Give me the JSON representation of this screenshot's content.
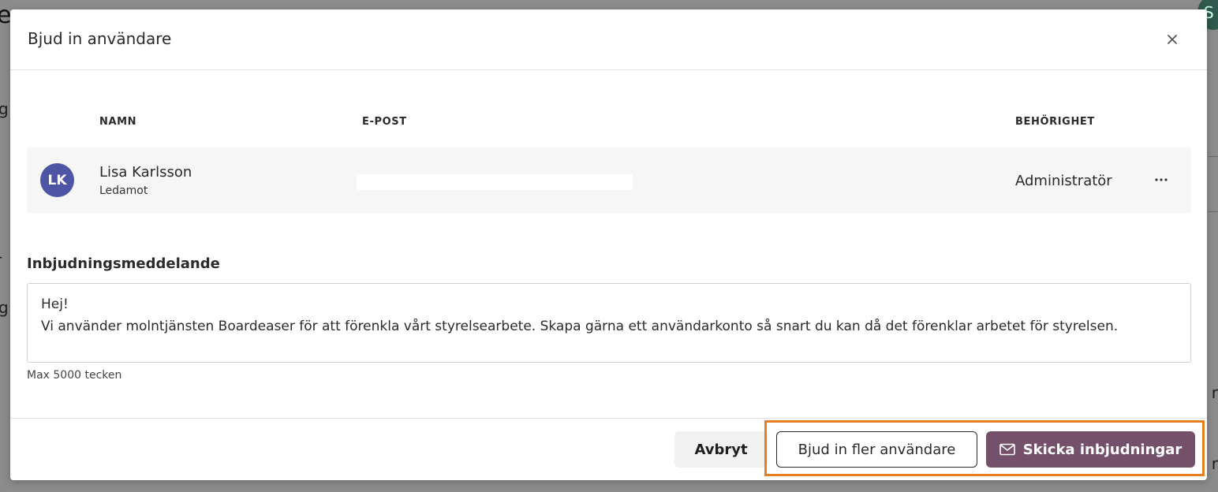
{
  "background": {
    "fragments": [
      "e",
      "g",
      "r",
      "g",
      "r",
      "r"
    ],
    "avatar_letter": "S"
  },
  "modal": {
    "title": "Bjud in användare",
    "close_icon": "close-icon"
  },
  "table": {
    "headers": {
      "name": "NAMN",
      "email": "E-POST",
      "permission": "BEHÖRIGHET"
    },
    "rows": [
      {
        "initials": "LK",
        "name": "Lisa Karlsson",
        "role": "Ledamot",
        "email": "",
        "permission": "Administratör",
        "more_icon": "more-horizontal-icon",
        "avatar_color": "#4e55a5"
      }
    ]
  },
  "message": {
    "label": "Inbjudningsmeddelande",
    "value": "Hej!\nVi använder molntjänsten Boardeaser för att förenkla vårt styrelsearbete. Skapa gärna ett användarkonto så snart du kan då det förenklar arbetet för styrelsen.",
    "hint": "Max 5000 tecken"
  },
  "footer": {
    "cancel_label": "Avbryt",
    "invite_more_label": "Bjud in fler användare",
    "send_label": "Skicka inbjudningar",
    "send_icon": "envelope-icon",
    "highlight_color": "#e67e22",
    "primary_color": "#74506a"
  }
}
